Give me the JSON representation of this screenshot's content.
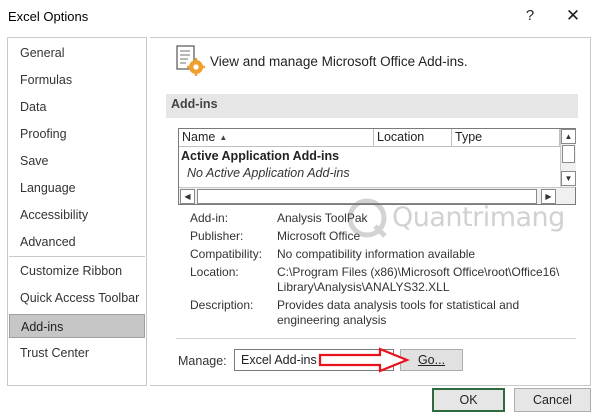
{
  "window": {
    "title": "Excel Options",
    "help_glyph": "?",
    "close_glyph": "✕"
  },
  "sidebar": {
    "items": [
      {
        "label": "General"
      },
      {
        "label": "Formulas"
      },
      {
        "label": "Data"
      },
      {
        "label": "Proofing"
      },
      {
        "label": "Save"
      },
      {
        "label": "Language"
      },
      {
        "label": "Accessibility"
      },
      {
        "label": "Advanced"
      },
      {
        "label": "Customize Ribbon"
      },
      {
        "label": "Quick Access Toolbar"
      },
      {
        "label": "Add-ins"
      },
      {
        "label": "Trust Center"
      }
    ],
    "selected": "Add-ins"
  },
  "header": {
    "icon": "gear-document-icon",
    "text": "View and manage Microsoft Office Add-ins."
  },
  "addins": {
    "section_title": "Add-ins",
    "columns": [
      "Name",
      "Location",
      "Type"
    ],
    "sort_glyph": "▲",
    "group_label": "Active Application Add-ins",
    "empty_label": "No Active Application Add-ins"
  },
  "details": {
    "addin_label": "Add-in:",
    "addin_value": "Analysis ToolPak",
    "publisher_label": "Publisher:",
    "publisher_value": "Microsoft Office",
    "compat_label": "Compatibility:",
    "compat_value": "No compatibility information available",
    "location_label": "Location:",
    "location_value_1": "C:\\Program Files (x86)\\Microsoft Office\\root\\Office16\\",
    "location_value_2": "Library\\Analysis\\ANALYS32.XLL",
    "description_label": "Description:",
    "description_value_1": "Provides data analysis tools for statistical and",
    "description_value_2": "engineering analysis"
  },
  "watermark": {
    "text": "Quantrimang"
  },
  "manage": {
    "label": "Manage:",
    "selected": "Excel Add-ins",
    "go_label": "Go..."
  },
  "footer": {
    "ok_label": "OK",
    "cancel_label": "Cancel"
  },
  "colors": {
    "selected_bg": "#c6c6c6",
    "section_bg": "#e6e6e6",
    "ok_border": "#2d6b3f",
    "annotation_arrow": "#e8141c"
  }
}
